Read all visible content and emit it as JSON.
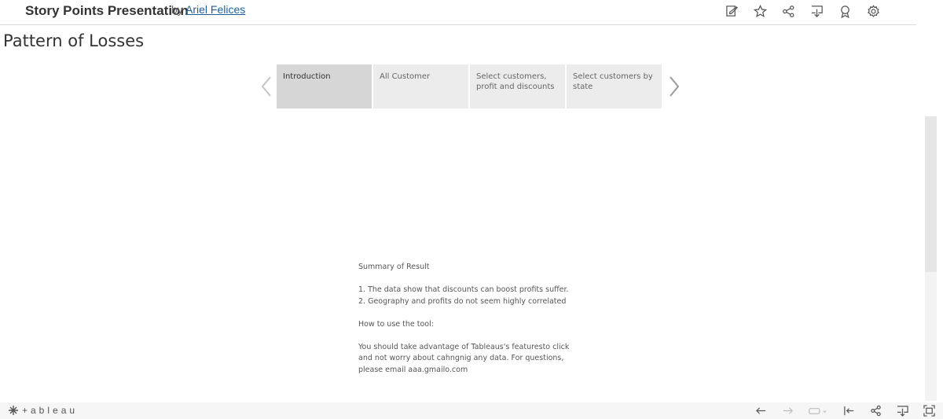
{
  "header": {
    "title": "Story Points Presentation",
    "by": "by",
    "author": "Ariel Felices",
    "icons": [
      "edit-icon",
      "favorite-star-icon",
      "share-icon",
      "download-icon",
      "metrics-icon",
      "settings-gear-icon"
    ]
  },
  "story": {
    "title": "Pattern of Losses",
    "points": [
      {
        "label": "Introduction",
        "active": true
      },
      {
        "label": "All Customer",
        "active": false
      },
      {
        "label": "Select customers, profit and discounts",
        "active": false
      },
      {
        "label": "Select customers by state",
        "active": false
      }
    ]
  },
  "summary": {
    "heading": "Summary of Result",
    "finding_1": "1. The data show that discounts can boost profits suffer.",
    "finding_2": "2. Geography and profits do not seem highly correlated",
    "howto_heading": "How to use the tool:",
    "howto_line_1": "You should take advantage of Tableaus's featuresto click",
    "howto_line_2": "and not worry about cahngnig any data. For questions,",
    "howto_line_3": "please email aaa.gmailo.com"
  },
  "footer": {
    "logo_text": "+ableau",
    "icons": [
      "undo-icon",
      "redo-icon",
      "revert-icon",
      "revert-dropdown-icon",
      "back-to-start-icon",
      "share-icon",
      "download-icon",
      "fullscreen-icon"
    ]
  },
  "colors": {
    "link": "#1f5f9c",
    "active_story_point": "#d6d6d6",
    "story_point": "#ececec"
  }
}
